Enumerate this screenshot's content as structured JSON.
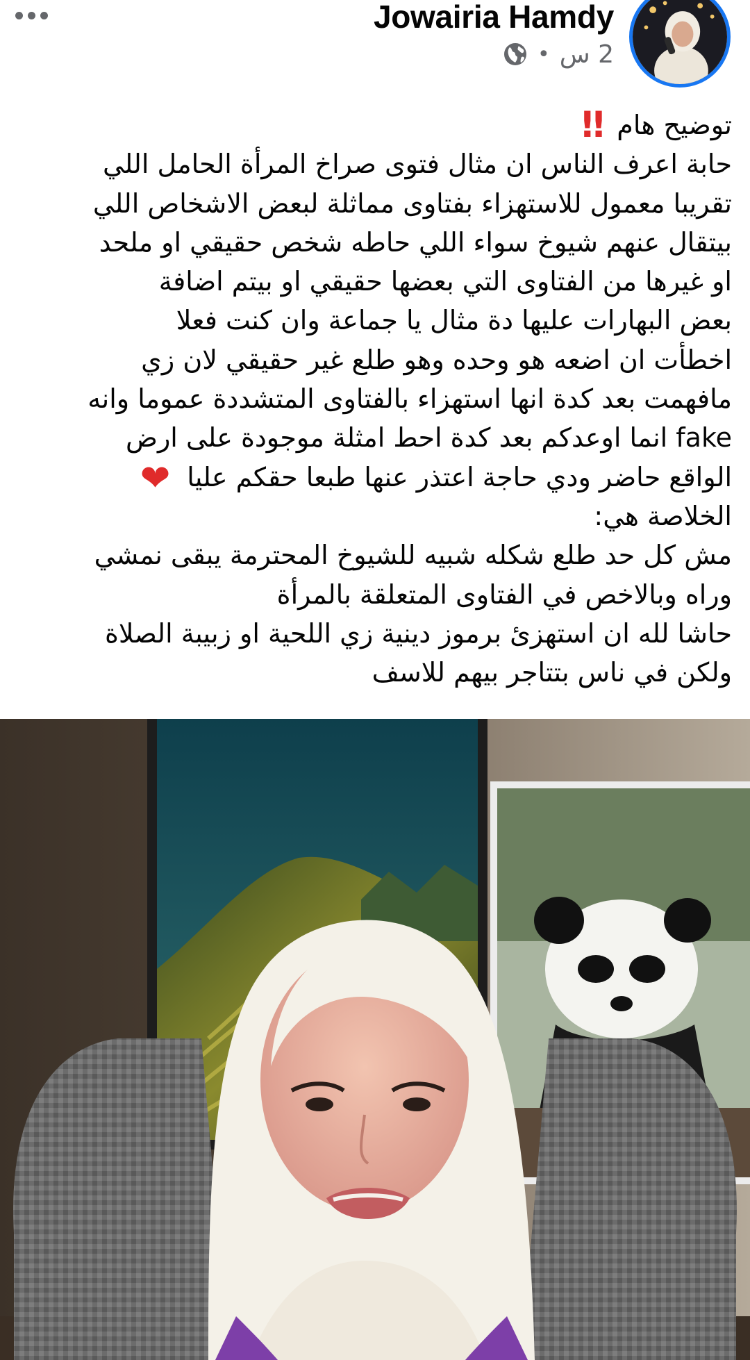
{
  "post": {
    "author_name": "Jowairia Hamdy",
    "time_label": "2 س",
    "separator": "•",
    "audience_icon": "globe-icon",
    "more_icon": "more-horizontal-icon",
    "lines": [
      "توضيح هام",
      "حابة اعرف الناس ان مثال فتوى صراخ المرأة الحامل اللي",
      "تقريبا معمول للاستهزاء بفتاوى مماثلة لبعض الاشخاص اللي",
      "بيتقال عنهم شيوخ سواء اللي حاطه شخص حقيقي او ملحد",
      "او غيرها من الفتاوى التي بعضها حقيقي او  بيتم اضافة",
      "بعض البهارات عليها دة مثال يا جماعة وان كنت فعلا",
      "اخطأت ان اضعه هو وحده وهو طلع غير حقيقي لان زي",
      "مافهمت بعد كدة انها استهزاء بالفتاوى المتشددة عموما وانه",
      "انما اوعدكم بعد كدة احط امثلة موجودة على ارض",
      "الواقع حاضر ودي حاجة اعتذر عنها طبعا حقكم عليا",
      "الخلاصة هي:",
      "مش كل حد طلع شكله شبيه للشيوخ المحترمة يبقى نمشي",
      "وراه وبالاخص في الفتاوى المتعلقة بالمرأة",
      "حاشا لله ان استهزئ برموز دينية زي اللحية او زبيبة الصلاة",
      "ولكن في ناس بتتاجر بيهم للاسف"
    ],
    "fake_word": "fake",
    "emoji_bang": "‼",
    "emoji_heart": "❤"
  },
  "colors": {
    "text": "#050505",
    "secondary": "#65676b",
    "avatar_ring": "#1877f2",
    "emoji_red": "#e02b2b"
  }
}
